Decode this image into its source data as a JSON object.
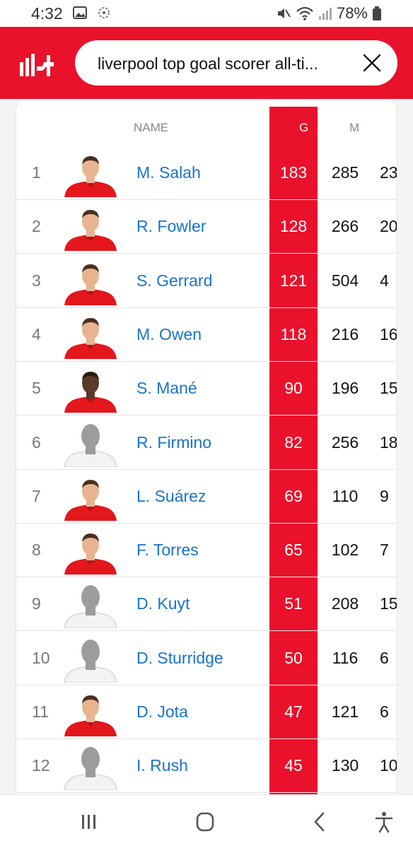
{
  "status": {
    "time": "4:32",
    "battery": "78%"
  },
  "search": {
    "query": "liverpool top goal scorer all-ti..."
  },
  "table": {
    "headers": {
      "name": "NAME",
      "goals": "G",
      "matches": "M"
    },
    "rows": [
      {
        "rank": "1",
        "name": "M. Salah",
        "goals": "183",
        "matches": "285",
        "extra": "23",
        "avatar": "player-photo"
      },
      {
        "rank": "2",
        "name": "R. Fowler",
        "goals": "128",
        "matches": "266",
        "extra": "20",
        "avatar": "player-photo"
      },
      {
        "rank": "3",
        "name": "S. Gerrard",
        "goals": "121",
        "matches": "504",
        "extra": "4",
        "avatar": "player-photo"
      },
      {
        "rank": "4",
        "name": "M. Owen",
        "goals": "118",
        "matches": "216",
        "extra": "16",
        "avatar": "player-photo"
      },
      {
        "rank": "5",
        "name": "S. Mané",
        "goals": "90",
        "matches": "196",
        "extra": "15",
        "avatar": "player-photo-dark"
      },
      {
        "rank": "6",
        "name": "R. Firmino",
        "goals": "82",
        "matches": "256",
        "extra": "18",
        "avatar": "silhouette"
      },
      {
        "rank": "7",
        "name": "L. Suárez",
        "goals": "69",
        "matches": "110",
        "extra": "9",
        "avatar": "player-photo"
      },
      {
        "rank": "8",
        "name": "F. Torres",
        "goals": "65",
        "matches": "102",
        "extra": "7",
        "avatar": "player-photo"
      },
      {
        "rank": "9",
        "name": "D. Kuyt",
        "goals": "51",
        "matches": "208",
        "extra": "15",
        "avatar": "silhouette"
      },
      {
        "rank": "10",
        "name": "D. Sturridge",
        "goals": "50",
        "matches": "116",
        "extra": "6",
        "avatar": "silhouette"
      },
      {
        "rank": "11",
        "name": "D. Jota",
        "goals": "47",
        "matches": "121",
        "extra": "6",
        "avatar": "player-photo"
      },
      {
        "rank": "12",
        "name": "I. Rush",
        "goals": "45",
        "matches": "130",
        "extra": "10",
        "avatar": "silhouette"
      }
    ]
  },
  "colors": {
    "brand_red": "#e9112b",
    "link_blue": "#1a73c9"
  }
}
